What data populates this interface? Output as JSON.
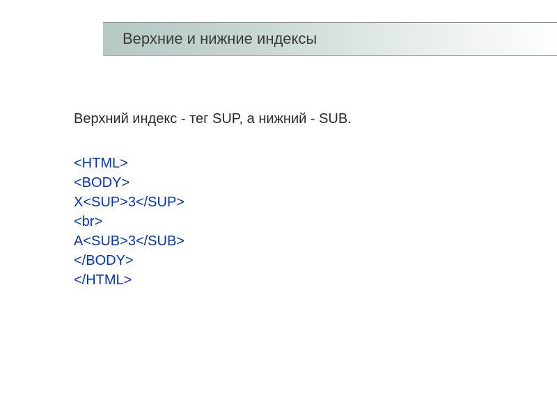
{
  "header": {
    "title": "Верхние и нижние индексы"
  },
  "content": {
    "intro": "Верхний индекс - тег SUP, а нижний - SUB.",
    "code": {
      "line1": "<HTML>",
      "line2": "<BODY>",
      "line3": "X<SUP>3</SUP>",
      "line4": "<br>",
      "line5": "A<SUB>3</SUB>",
      "line6": "</BODY>",
      "line7": "</HTML>"
    }
  }
}
